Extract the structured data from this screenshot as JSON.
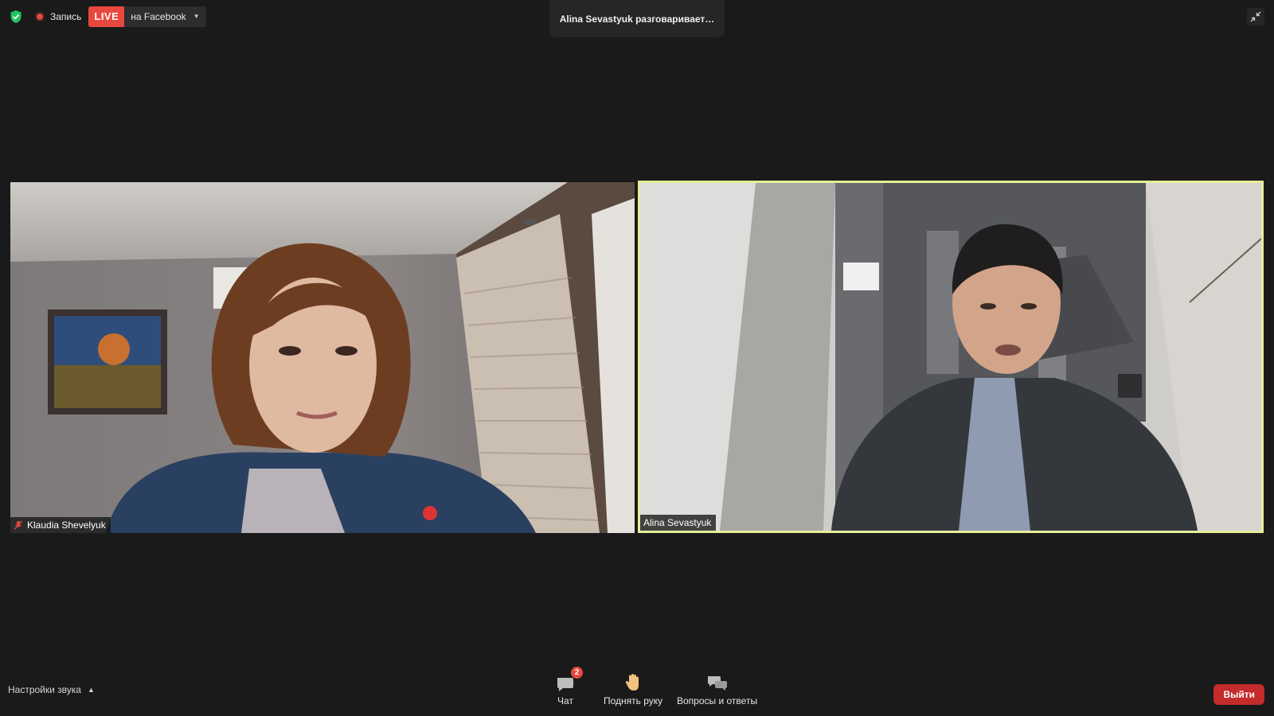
{
  "topbar": {
    "recording_label": "Запись",
    "live_label": "LIVE",
    "live_destination": "на Facebook",
    "speaker_status": "Alina Sevastyuk разговаривает…"
  },
  "participants": [
    {
      "name": "Klaudia Shevelyuk",
      "muted": true
    },
    {
      "name": "Alina Sevastyuk",
      "muted": false,
      "active_speaker": true
    }
  ],
  "toolbar": {
    "audio_settings": "Настройки звука",
    "chat_label": "Чат",
    "chat_badge": "2",
    "raise_hand_label": "Поднять руку",
    "qa_label": "Вопросы и ответы",
    "leave_label": "Выйти"
  },
  "colors": {
    "live_red": "#e8483f",
    "active_border": "#e6ee9a",
    "leave_red": "#c42b2b",
    "shield_green": "#22c55e"
  }
}
